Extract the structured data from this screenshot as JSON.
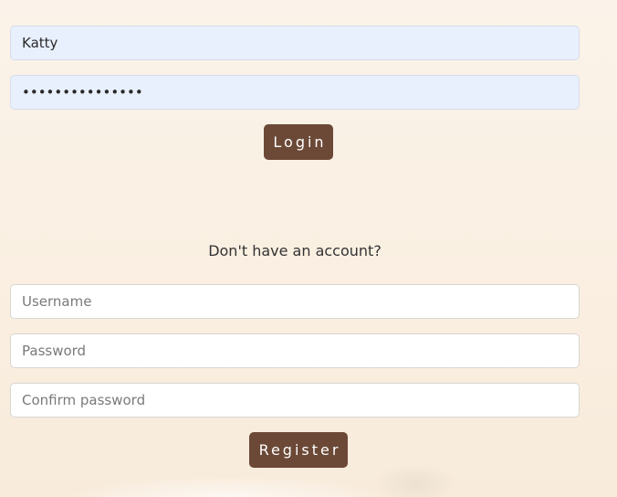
{
  "login": {
    "username_value": "Katty",
    "password_value": "•••••••••••••••",
    "button_label": "Login"
  },
  "register": {
    "prompt": "Don't have an account?",
    "username_placeholder": "Username",
    "password_placeholder": "Password",
    "confirm_placeholder": "Confirm password",
    "button_label": "Register"
  },
  "colors": {
    "button_bg": "#6b4936",
    "autofill_bg": "#e8f0fe",
    "page_bg": "#faf0e3"
  }
}
